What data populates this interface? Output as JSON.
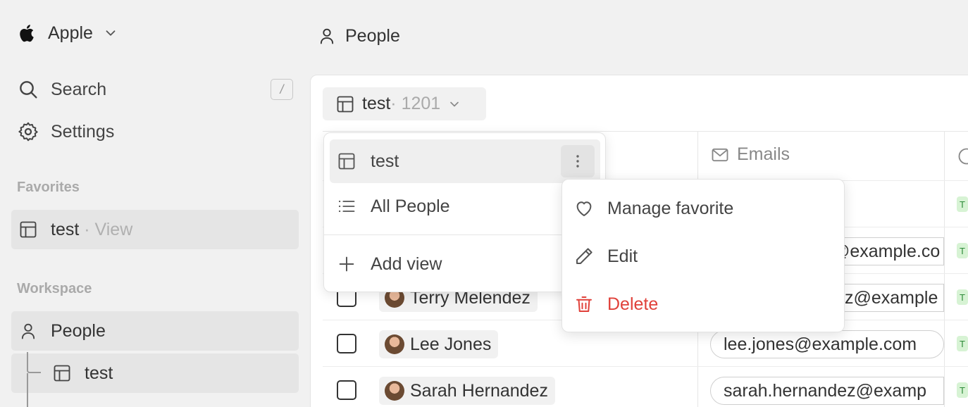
{
  "workspace": {
    "name": "Apple"
  },
  "sidebar": {
    "search_label": "Search",
    "search_shortcut": "/",
    "settings_label": "Settings",
    "favorites_title": "Favorites",
    "favorite_item": {
      "name": "test",
      "suffix": " · View"
    },
    "workspace_title": "Workspace",
    "workspace_items": [
      {
        "label": "People"
      },
      {
        "label": "test"
      }
    ]
  },
  "header": {
    "title": "People"
  },
  "view_selector": {
    "name": "test",
    "count": " · 1201"
  },
  "table": {
    "columns": [
      {
        "label": "Emails",
        "icon": "mail-icon"
      }
    ],
    "rows": [
      {
        "name": "Terry Melendez",
        "email": "z@example"
      },
      {
        "name": "Lee Jones",
        "email": "lee.jones@example.com"
      },
      {
        "name": "Sarah Hernandez",
        "email": "sarah.hernandez@examp"
      }
    ],
    "partial_email": "@example.co",
    "tag_letter": "T"
  },
  "views_menu": {
    "items": [
      {
        "label": "test",
        "icon": "table-icon",
        "active": true
      },
      {
        "label": "All People",
        "icon": "list-icon",
        "active": false
      }
    ],
    "add_label": "Add view"
  },
  "context_menu": {
    "items": [
      {
        "label": "Manage favorite",
        "icon": "heart-icon"
      },
      {
        "label": "Edit",
        "icon": "pencil-icon"
      },
      {
        "label": "Delete",
        "icon": "trash-icon",
        "danger": true
      }
    ]
  },
  "colors": {
    "danger": "#e0413a",
    "tag_bg": "#d7f3d4",
    "tag_fg": "#2e8b3a"
  }
}
